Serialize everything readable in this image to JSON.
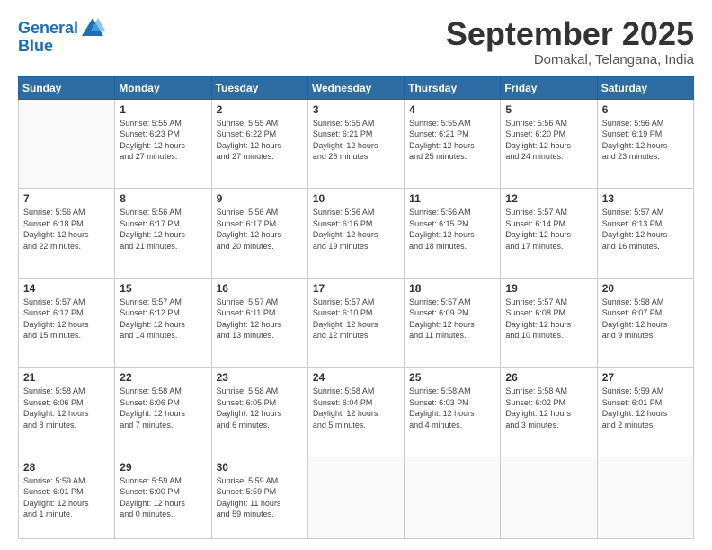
{
  "logo": {
    "line1": "General",
    "line2": "Blue"
  },
  "header": {
    "month": "September 2025",
    "location": "Dornakal, Telangana, India"
  },
  "weekdays": [
    "Sunday",
    "Monday",
    "Tuesday",
    "Wednesday",
    "Thursday",
    "Friday",
    "Saturday"
  ],
  "weeks": [
    [
      {
        "day": "",
        "info": ""
      },
      {
        "day": "1",
        "info": "Sunrise: 5:55 AM\nSunset: 6:23 PM\nDaylight: 12 hours\nand 27 minutes."
      },
      {
        "day": "2",
        "info": "Sunrise: 5:55 AM\nSunset: 6:22 PM\nDaylight: 12 hours\nand 27 minutes."
      },
      {
        "day": "3",
        "info": "Sunrise: 5:55 AM\nSunset: 6:21 PM\nDaylight: 12 hours\nand 26 minutes."
      },
      {
        "day": "4",
        "info": "Sunrise: 5:55 AM\nSunset: 6:21 PM\nDaylight: 12 hours\nand 25 minutes."
      },
      {
        "day": "5",
        "info": "Sunrise: 5:56 AM\nSunset: 6:20 PM\nDaylight: 12 hours\nand 24 minutes."
      },
      {
        "day": "6",
        "info": "Sunrise: 5:56 AM\nSunset: 6:19 PM\nDaylight: 12 hours\nand 23 minutes."
      }
    ],
    [
      {
        "day": "7",
        "info": "Sunrise: 5:56 AM\nSunset: 6:18 PM\nDaylight: 12 hours\nand 22 minutes."
      },
      {
        "day": "8",
        "info": "Sunrise: 5:56 AM\nSunset: 6:17 PM\nDaylight: 12 hours\nand 21 minutes."
      },
      {
        "day": "9",
        "info": "Sunrise: 5:56 AM\nSunset: 6:17 PM\nDaylight: 12 hours\nand 20 minutes."
      },
      {
        "day": "10",
        "info": "Sunrise: 5:56 AM\nSunset: 6:16 PM\nDaylight: 12 hours\nand 19 minutes."
      },
      {
        "day": "11",
        "info": "Sunrise: 5:56 AM\nSunset: 6:15 PM\nDaylight: 12 hours\nand 18 minutes."
      },
      {
        "day": "12",
        "info": "Sunrise: 5:57 AM\nSunset: 6:14 PM\nDaylight: 12 hours\nand 17 minutes."
      },
      {
        "day": "13",
        "info": "Sunrise: 5:57 AM\nSunset: 6:13 PM\nDaylight: 12 hours\nand 16 minutes."
      }
    ],
    [
      {
        "day": "14",
        "info": "Sunrise: 5:57 AM\nSunset: 6:12 PM\nDaylight: 12 hours\nand 15 minutes."
      },
      {
        "day": "15",
        "info": "Sunrise: 5:57 AM\nSunset: 6:12 PM\nDaylight: 12 hours\nand 14 minutes."
      },
      {
        "day": "16",
        "info": "Sunrise: 5:57 AM\nSunset: 6:11 PM\nDaylight: 12 hours\nand 13 minutes."
      },
      {
        "day": "17",
        "info": "Sunrise: 5:57 AM\nSunset: 6:10 PM\nDaylight: 12 hours\nand 12 minutes."
      },
      {
        "day": "18",
        "info": "Sunrise: 5:57 AM\nSunset: 6:09 PM\nDaylight: 12 hours\nand 11 minutes."
      },
      {
        "day": "19",
        "info": "Sunrise: 5:57 AM\nSunset: 6:08 PM\nDaylight: 12 hours\nand 10 minutes."
      },
      {
        "day": "20",
        "info": "Sunrise: 5:58 AM\nSunset: 6:07 PM\nDaylight: 12 hours\nand 9 minutes."
      }
    ],
    [
      {
        "day": "21",
        "info": "Sunrise: 5:58 AM\nSunset: 6:06 PM\nDaylight: 12 hours\nand 8 minutes."
      },
      {
        "day": "22",
        "info": "Sunrise: 5:58 AM\nSunset: 6:06 PM\nDaylight: 12 hours\nand 7 minutes."
      },
      {
        "day": "23",
        "info": "Sunrise: 5:58 AM\nSunset: 6:05 PM\nDaylight: 12 hours\nand 6 minutes."
      },
      {
        "day": "24",
        "info": "Sunrise: 5:58 AM\nSunset: 6:04 PM\nDaylight: 12 hours\nand 5 minutes."
      },
      {
        "day": "25",
        "info": "Sunrise: 5:58 AM\nSunset: 6:03 PM\nDaylight: 12 hours\nand 4 minutes."
      },
      {
        "day": "26",
        "info": "Sunrise: 5:58 AM\nSunset: 6:02 PM\nDaylight: 12 hours\nand 3 minutes."
      },
      {
        "day": "27",
        "info": "Sunrise: 5:59 AM\nSunset: 6:01 PM\nDaylight: 12 hours\nand 2 minutes."
      }
    ],
    [
      {
        "day": "28",
        "info": "Sunrise: 5:59 AM\nSunset: 6:01 PM\nDaylight: 12 hours\nand 1 minute."
      },
      {
        "day": "29",
        "info": "Sunrise: 5:59 AM\nSunset: 6:00 PM\nDaylight: 12 hours\nand 0 minutes."
      },
      {
        "day": "30",
        "info": "Sunrise: 5:59 AM\nSunset: 5:59 PM\nDaylight: 11 hours\nand 59 minutes."
      },
      {
        "day": "",
        "info": ""
      },
      {
        "day": "",
        "info": ""
      },
      {
        "day": "",
        "info": ""
      },
      {
        "day": "",
        "info": ""
      }
    ]
  ]
}
